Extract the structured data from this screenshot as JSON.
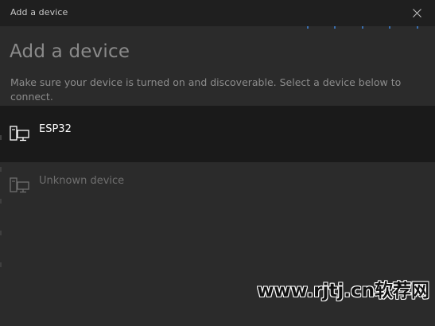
{
  "window": {
    "title": "Add a device",
    "close_icon": "close-icon"
  },
  "main": {
    "heading": "Add a device",
    "subtitle": "Make sure your device is turned on and discoverable. Select a device below to connect."
  },
  "devices": [
    {
      "label": "ESP32",
      "icon": "computer-monitor-icon",
      "selected": true
    },
    {
      "label": "Unknown device",
      "icon": "computer-monitor-icon",
      "selected": false
    }
  ],
  "colors": {
    "titlebar": "#1f1f1f",
    "background": "#2b2b2b",
    "selected_row": "#1a1a1a",
    "accent_dots": "#3a6fb0"
  },
  "watermark": "www.rjtj.cn软荐网"
}
